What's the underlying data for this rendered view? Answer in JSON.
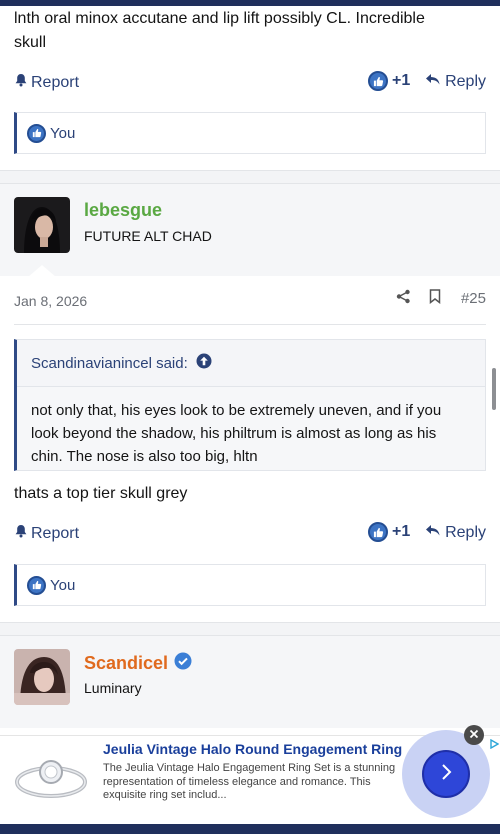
{
  "posts": [
    {
      "text_line1": "lnth oral minox accutane and lip lift possibly CL. Incredible",
      "text_line2": "skull",
      "actions": {
        "report": "Report",
        "like_count": "+1",
        "reply": "Reply"
      },
      "likes": "You"
    },
    {
      "username": "lebesgue",
      "user_title": "FUTURE ALT CHAD",
      "date": "Jan 8, 2026",
      "post_number": "#25",
      "quote": {
        "author": "Scandinavianincel said:",
        "line1": "not only that, his eyes look to be extremely uneven, and if you",
        "line2": "look beyond the shadow, his philtrum is almost as long as his",
        "line3": "chin. The nose is also too big, hltn"
      },
      "text": "thats a top tier skull grey",
      "actions": {
        "report": "Report",
        "like_count": "+1",
        "reply": "Reply"
      },
      "likes": "You"
    },
    {
      "username": "Scandicel",
      "user_title": "Luminary"
    }
  ],
  "ad": {
    "title": "Jeulia Vintage Halo Round Engagement Ring",
    "desc_line1": "The Jeulia Vintage Halo Engagement Ring Set is a stunning",
    "desc_line2": "representation of timeless elegance and romance. This",
    "desc_line3": "exquisite ring set includ..."
  },
  "colors": {
    "nav": "#1f2f5c",
    "link": "#2b4277",
    "user_green": "#5aa843",
    "user_orange": "#e06a1e",
    "verified": "#3b7fd6"
  },
  "icons": [
    "bell-icon",
    "like-thumb-icon",
    "reply-arrow-icon",
    "share-icon",
    "bookmark-icon",
    "quote-up-arrow-icon",
    "verified-badge-icon",
    "chevron-right-icon",
    "close-icon",
    "adchoices-icon"
  ]
}
